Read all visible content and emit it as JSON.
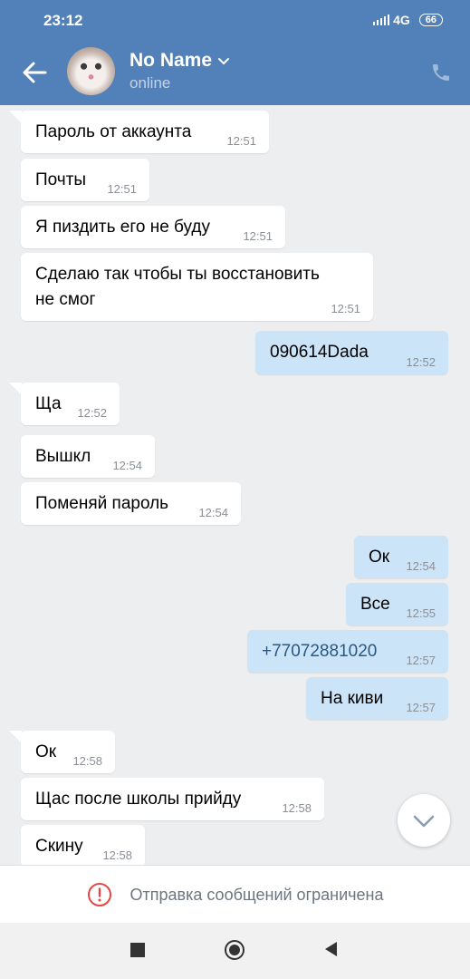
{
  "status_bar": {
    "time": "23:12",
    "network": "4G",
    "battery": "66"
  },
  "header": {
    "title": "No Name",
    "subtitle": "online"
  },
  "messages": [
    {
      "text": "Пароль от аккаунта",
      "time": "12:51"
    },
    {
      "text": "Почты",
      "time": "12:51"
    },
    {
      "text": "Я пиздить его не буду",
      "time": "12:51"
    },
    {
      "text": "Сделаю так чтобы ты восстановить\nне смог",
      "time": "12:51"
    },
    {
      "text": "090614Dada",
      "time": "12:52"
    },
    {
      "text": "Ща",
      "time": "12:52"
    },
    {
      "text": "Вышкл",
      "time": "12:54"
    },
    {
      "text": "Поменяй пароль",
      "time": "12:54"
    },
    {
      "text": "Ок",
      "time": "12:54"
    },
    {
      "text": "Все",
      "time": "12:55"
    },
    {
      "text": "+77072881020",
      "time": "12:57"
    },
    {
      "text": "На киви",
      "time": "12:57"
    },
    {
      "text": "Ок",
      "time": "12:58"
    },
    {
      "text": "Щас после школы прийду",
      "time": "12:58"
    },
    {
      "text": "Скину",
      "time": "12:58"
    }
  ],
  "restriction": {
    "text": "Отправка сообщений ограничена"
  },
  "colors": {
    "header": "#5181b8",
    "incoming": "#ffffff",
    "outgoing": "#cce4f7",
    "background": "#edeef0"
  },
  "icons": [
    "back-arrow-icon",
    "chevron-down-icon",
    "phone-icon",
    "chevron-down-icon",
    "alert-circle-icon",
    "square-icon",
    "circle-icon",
    "triangle-back-icon"
  ]
}
